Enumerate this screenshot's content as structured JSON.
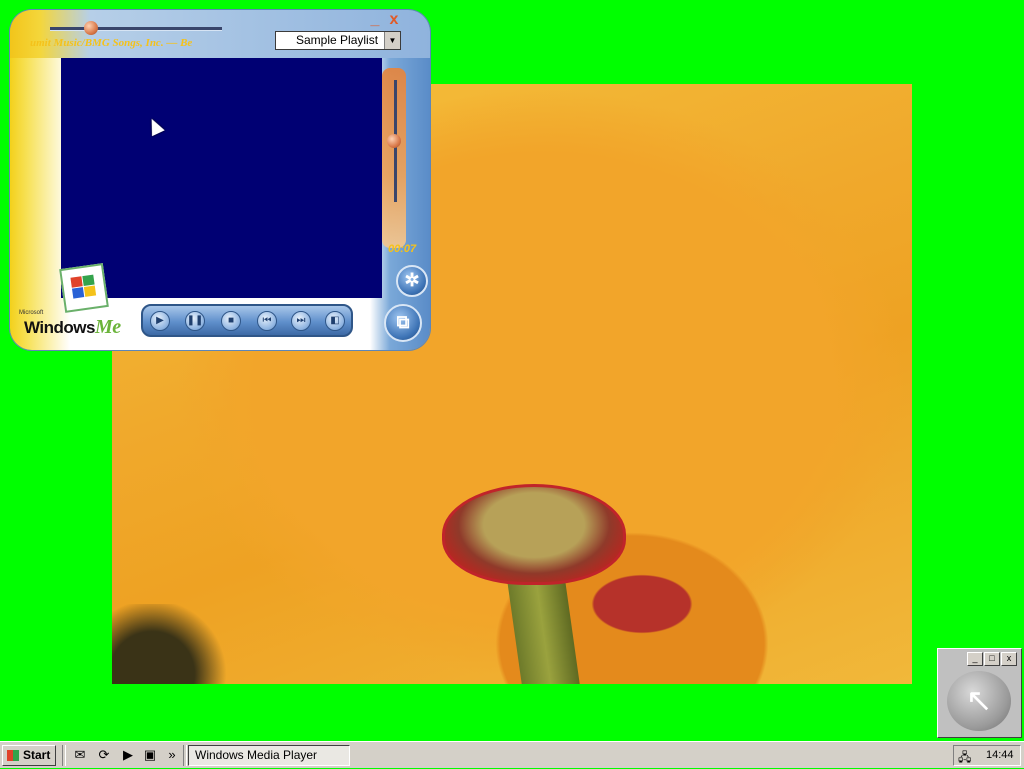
{
  "player": {
    "marquee": "umit Music/BMG Songs, Inc. — Be",
    "playlist_selected": "Sample Playlist",
    "time": "00:07",
    "seek_progress": 0.3,
    "volume_level": 0.45,
    "minimize_label": "_",
    "close_label": "x",
    "buttons": {
      "play": "▶",
      "pause": "❚❚",
      "stop": "■",
      "prev": "⏮",
      "next": "⏭",
      "mute": "◧",
      "visualization": "✲",
      "full_mode": "⧉"
    },
    "logo_text": "Windows",
    "logo_me": "Me",
    "logo_small": "Microsoft"
  },
  "mini_player": {
    "minimize": "_",
    "maximize": "□",
    "close": "x",
    "restore_icon": "↖"
  },
  "taskbar": {
    "start_label": "Start",
    "quicklaunch": [
      "✉",
      "⟳",
      "▶",
      "▣"
    ],
    "chevron": "»",
    "task_button": "Windows Media Player",
    "clock": "14:44"
  },
  "colors": {
    "desktop": "#00ff00",
    "video_bg": "#000073",
    "accent_yellow": "#f5c21a",
    "taskbar": "#d4d0c8"
  },
  "icons": {
    "cursor": "arrow-cursor-icon",
    "network": "network-icon"
  }
}
